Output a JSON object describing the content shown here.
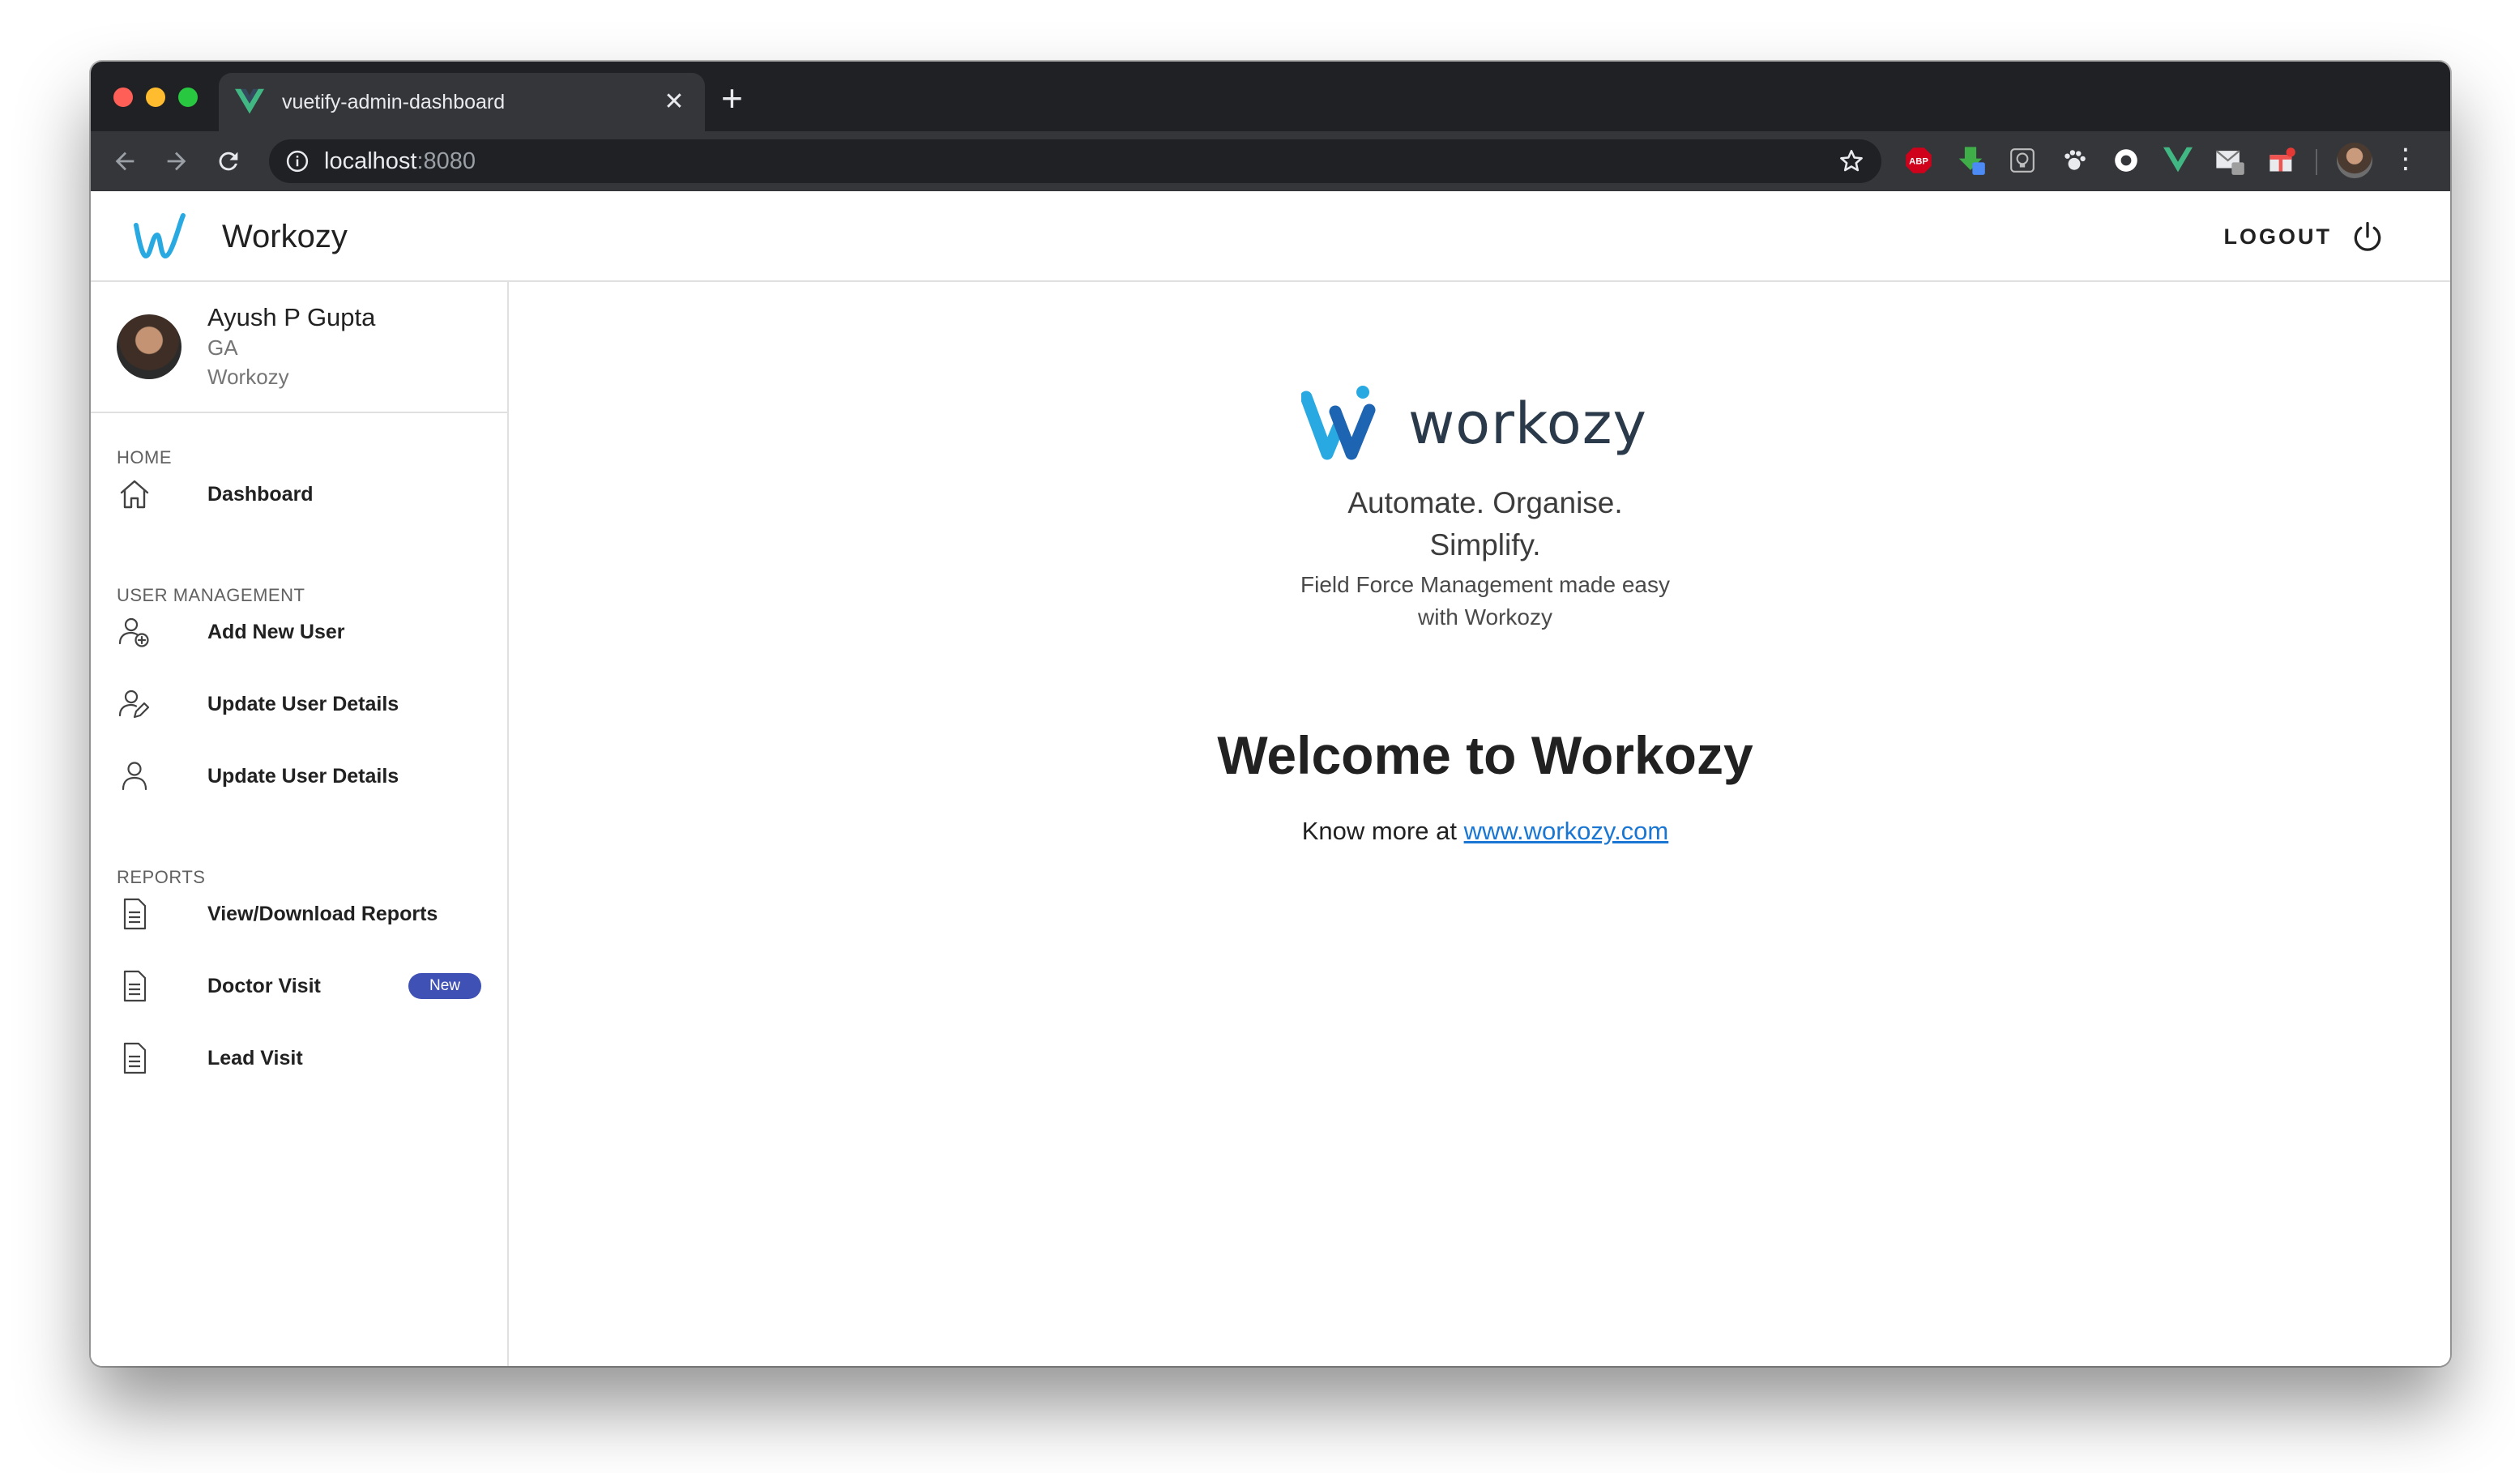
{
  "browser": {
    "tab_title": "vuetify-admin-dashboard",
    "url_host": "localhost",
    "url_port": ":8080",
    "extensions": [
      "adblock-plus-icon",
      "downloader-icon",
      "lightbulb-icon",
      "paw-icon",
      "circle-icon",
      "vue-devtools-icon",
      "mail-icon",
      "gift-icon"
    ],
    "adblock_label": "ABP"
  },
  "app": {
    "title": "Workozy",
    "logout_label": "LOGOUT",
    "accent": "#3f51b5",
    "link_color": "#1976d2"
  },
  "user": {
    "name": "Ayush P Gupta",
    "role": "GA",
    "org": "Workozy"
  },
  "sidebar": {
    "sections": [
      {
        "header": "HOME",
        "items": [
          {
            "label": "Dashboard",
            "icon": "home-icon"
          }
        ]
      },
      {
        "header": "USER MANAGEMENT",
        "items": [
          {
            "label": "Add New User",
            "icon": "add-user-icon"
          },
          {
            "label": "Update User Details",
            "icon": "edit-user-icon"
          },
          {
            "label": "Update User Details",
            "icon": "user-icon"
          }
        ]
      },
      {
        "header": "REPORTS",
        "items": [
          {
            "label": "View/Download Reports",
            "icon": "document-icon"
          },
          {
            "label": "Doctor Visit",
            "icon": "document-icon",
            "badge": "New"
          },
          {
            "label": "Lead Visit",
            "icon": "document-icon"
          }
        ]
      }
    ]
  },
  "main": {
    "brand_wordmark": "workozy",
    "tagline_line1": "Automate. Organise.",
    "tagline_line2": "Simplify.",
    "subtagline_line1": "Field Force Management made easy",
    "subtagline_line2": "with Workozy",
    "welcome": "Welcome to Workozy",
    "know_more_prefix": "Know more at ",
    "know_more_link": "www.workozy.com"
  }
}
